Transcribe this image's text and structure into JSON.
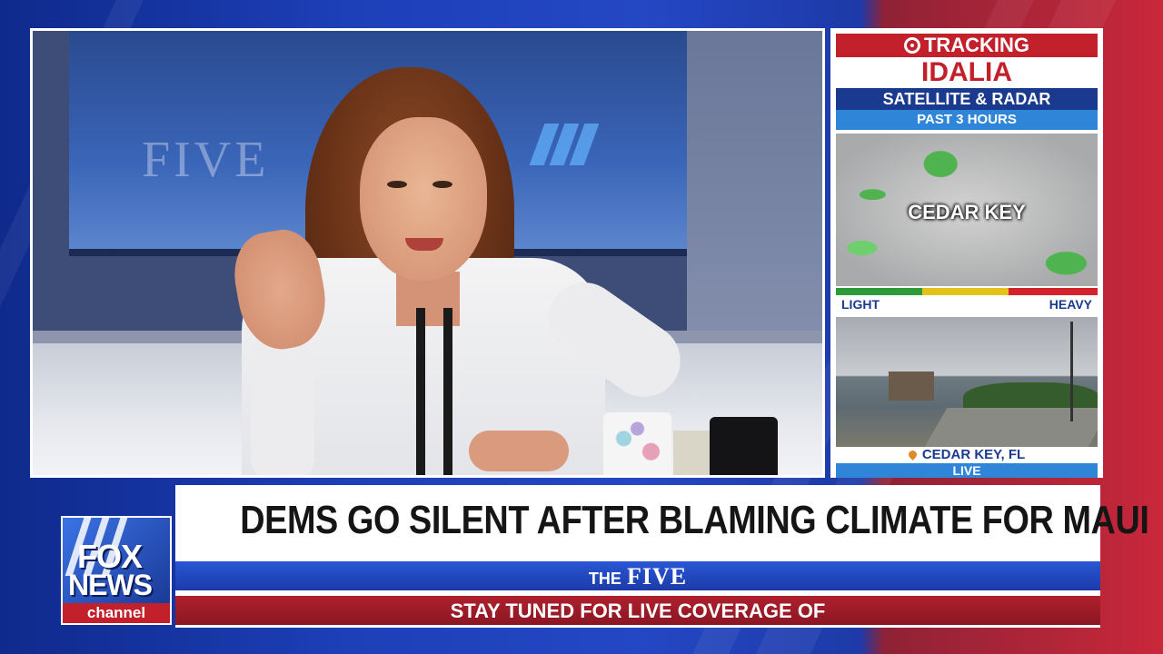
{
  "weather": {
    "tracking_label": "TRACKING",
    "storm_name": "IDALIA",
    "product_label": "SATELLITE & RADAR",
    "time_window": "PAST 3 HOURS",
    "map_label": "CEDAR KEY",
    "legend_light": "LIGHT",
    "legend_heavy": "HEAVY",
    "camera_location": "CEDAR KEY, FL",
    "camera_status": "LIVE",
    "colors": {
      "alert_red": "#c2202b",
      "navy": "#1a3a8f",
      "sky_blue": "#2f86d8"
    }
  },
  "lower_third": {
    "headline": "DEMS GO SILENT AFTER BLAMING CLIMATE FOR MAUI",
    "show_prefix": "THE",
    "show_name": "FIVE",
    "ticker": "STAY TUNED FOR LIVE COVERAGE OF"
  },
  "logo": {
    "line1": "FOX",
    "line2": "NEWS",
    "line3": "channel"
  },
  "background_screen": {
    "text": "FIVE"
  },
  "icons": [
    "tracking-target-icon",
    "location-pin-icon"
  ]
}
